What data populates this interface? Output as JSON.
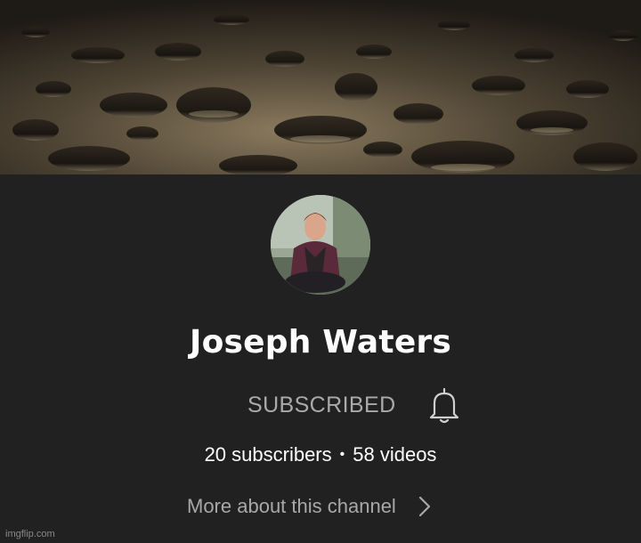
{
  "banner": {
    "image": "water-droplets-banner"
  },
  "avatar": {
    "image": "profile-photo"
  },
  "channel": {
    "name": "Joseph Waters",
    "subscribe_label": "SUBSCRIBED",
    "subscribers": "20 subscribers",
    "separator": "•",
    "videos": "58 videos",
    "more_label": "More about this channel"
  },
  "icons": {
    "bell": "bell-icon",
    "chevron": "chevron-right-icon"
  },
  "watermark": "imgflip.com",
  "colors": {
    "background": "#212121",
    "primary_text": "#ffffff",
    "secondary_text": "#aaaaaa"
  }
}
